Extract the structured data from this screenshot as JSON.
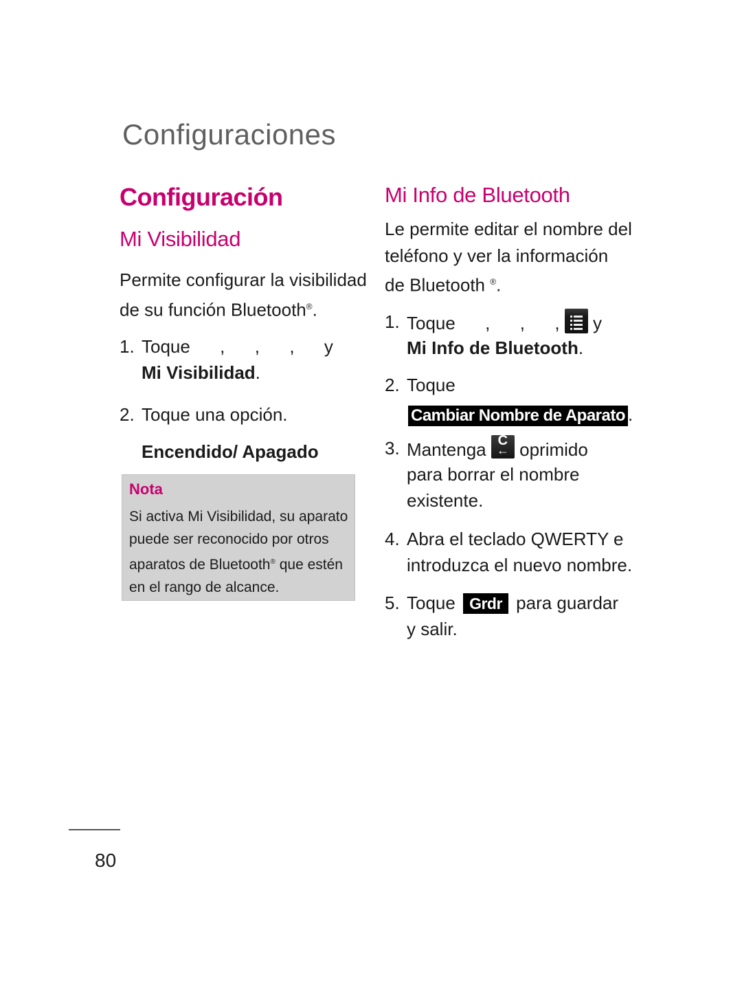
{
  "chapter_title": "Configuraciones",
  "section_title": "Configuración",
  "left": {
    "subtitle": "Mi Visibilidad",
    "intro_line1": "Permite configurar la visibilidad",
    "intro_line2": "de su función Bluetooth",
    "registered": "®",
    "period": ".",
    "step1": {
      "num": "1.",
      "text": "Toque      ,      ,      ,      y",
      "bold": "Mi Visibilidad",
      "end": "."
    },
    "step2": {
      "num": "2.",
      "text": "Toque una opción."
    },
    "option": "Encendido/ Apagado",
    "note": {
      "label": "Nota",
      "line1": "Si activa Mi Visibilidad, su aparato",
      "line2": "puede ser reconocido por otros",
      "line3a": "aparatos de Bluetooth",
      "line3b": " que estén",
      "line4": "en el rango de alcance."
    }
  },
  "right": {
    "subtitle": "Mi Info de Bluetooth",
    "intro_line1": "Le permite editar el nombre del",
    "intro_line2": "teléfono y ver la información",
    "intro_line3": "de Bluetooth ",
    "step1": {
      "num": "1.",
      "text": "Toque      ,      ,      ,",
      "y": "y",
      "bold": "Mi Info de Bluetooth",
      "end": "."
    },
    "step2": {
      "num": "2.",
      "text": "Toque",
      "key": "Cambiar Nombre de Aparato",
      "end": "."
    },
    "step3": {
      "num": "3.",
      "text_a": "Mantenga",
      "icon_glyph": "C",
      "text_b": "oprimido",
      "line2": "para borrar el nombre",
      "line3": "existente."
    },
    "step4": {
      "num": "4.",
      "line1": "Abra el teclado QWERTY e",
      "line2": "introduzca el nuevo nombre."
    },
    "step5": {
      "num": "5.",
      "text_a": "Toque",
      "key": "Grdr",
      "text_b": "para guardar",
      "line2": "y salir."
    }
  },
  "page_number": "80",
  "colors": {
    "accent": "#c8006e",
    "chapter_gray": "#5f5f5f",
    "note_bg": "#d2d2d2"
  }
}
